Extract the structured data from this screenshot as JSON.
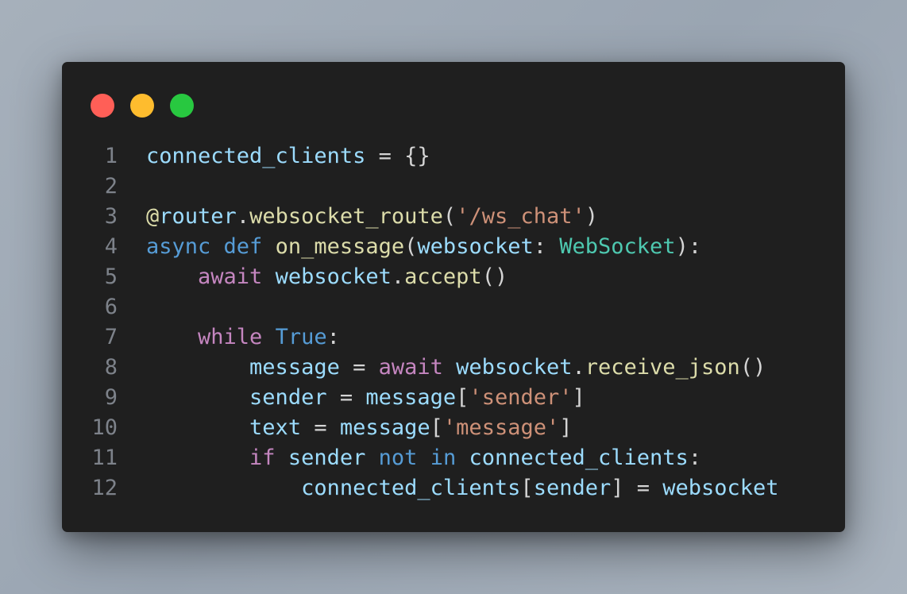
{
  "window": {
    "controls": [
      "close-dot",
      "minimize-dot",
      "maximize-dot"
    ],
    "colors": {
      "close": "#ff5f57",
      "minimize": "#febc2e",
      "maximize": "#28c840",
      "background": "#1f1f1f"
    }
  },
  "code": {
    "language": "python",
    "lines": [
      {
        "number": "1",
        "tokens": [
          {
            "t": "var",
            "s": "connected_clients"
          },
          {
            "t": "pun",
            "s": " = {}"
          }
        ]
      },
      {
        "number": "2",
        "tokens": []
      },
      {
        "number": "3",
        "tokens": [
          {
            "t": "fn",
            "s": "@"
          },
          {
            "t": "var",
            "s": "router"
          },
          {
            "t": "pun",
            "s": "."
          },
          {
            "t": "fn",
            "s": "websocket_route"
          },
          {
            "t": "pun",
            "s": "("
          },
          {
            "t": "str",
            "s": "'/ws_chat'"
          },
          {
            "t": "pun",
            "s": ")"
          }
        ]
      },
      {
        "number": "4",
        "tokens": [
          {
            "t": "kw",
            "s": "async"
          },
          {
            "t": "pun",
            "s": " "
          },
          {
            "t": "kw",
            "s": "def"
          },
          {
            "t": "pun",
            "s": " "
          },
          {
            "t": "fn",
            "s": "on_message"
          },
          {
            "t": "pun",
            "s": "("
          },
          {
            "t": "var",
            "s": "websocket"
          },
          {
            "t": "pun",
            "s": ": "
          },
          {
            "t": "type",
            "s": "WebSocket"
          },
          {
            "t": "pun",
            "s": "):"
          }
        ]
      },
      {
        "number": "5",
        "tokens": [
          {
            "t": "pun",
            "s": "    "
          },
          {
            "t": "ctl",
            "s": "await"
          },
          {
            "t": "pun",
            "s": " "
          },
          {
            "t": "var",
            "s": "websocket"
          },
          {
            "t": "pun",
            "s": "."
          },
          {
            "t": "fn",
            "s": "accept"
          },
          {
            "t": "pun",
            "s": "()"
          }
        ]
      },
      {
        "number": "6",
        "tokens": []
      },
      {
        "number": "7",
        "tokens": [
          {
            "t": "pun",
            "s": "    "
          },
          {
            "t": "ctl",
            "s": "while"
          },
          {
            "t": "pun",
            "s": " "
          },
          {
            "t": "kw",
            "s": "True"
          },
          {
            "t": "pun",
            "s": ":"
          }
        ]
      },
      {
        "number": "8",
        "tokens": [
          {
            "t": "pun",
            "s": "        "
          },
          {
            "t": "var",
            "s": "message"
          },
          {
            "t": "pun",
            "s": " = "
          },
          {
            "t": "ctl",
            "s": "await"
          },
          {
            "t": "pun",
            "s": " "
          },
          {
            "t": "var",
            "s": "websocket"
          },
          {
            "t": "pun",
            "s": "."
          },
          {
            "t": "fn",
            "s": "receive_json"
          },
          {
            "t": "pun",
            "s": "()"
          }
        ]
      },
      {
        "number": "9",
        "tokens": [
          {
            "t": "pun",
            "s": "        "
          },
          {
            "t": "var",
            "s": "sender"
          },
          {
            "t": "pun",
            "s": " = "
          },
          {
            "t": "var",
            "s": "message"
          },
          {
            "t": "pun",
            "s": "["
          },
          {
            "t": "str",
            "s": "'sender'"
          },
          {
            "t": "pun",
            "s": "]"
          }
        ]
      },
      {
        "number": "10",
        "tokens": [
          {
            "t": "pun",
            "s": "        "
          },
          {
            "t": "var",
            "s": "text"
          },
          {
            "t": "pun",
            "s": " = "
          },
          {
            "t": "var",
            "s": "message"
          },
          {
            "t": "pun",
            "s": "["
          },
          {
            "t": "str",
            "s": "'message'"
          },
          {
            "t": "pun",
            "s": "]"
          }
        ]
      },
      {
        "number": "11",
        "tokens": [
          {
            "t": "pun",
            "s": "        "
          },
          {
            "t": "ctl",
            "s": "if"
          },
          {
            "t": "pun",
            "s": " "
          },
          {
            "t": "var",
            "s": "sender"
          },
          {
            "t": "pun",
            "s": " "
          },
          {
            "t": "kw",
            "s": "not"
          },
          {
            "t": "pun",
            "s": " "
          },
          {
            "t": "kw",
            "s": "in"
          },
          {
            "t": "pun",
            "s": " "
          },
          {
            "t": "var",
            "s": "connected_clients"
          },
          {
            "t": "pun",
            "s": ":"
          }
        ]
      },
      {
        "number": "12",
        "tokens": [
          {
            "t": "pun",
            "s": "            "
          },
          {
            "t": "var",
            "s": "connected_clients"
          },
          {
            "t": "pun",
            "s": "["
          },
          {
            "t": "var",
            "s": "sender"
          },
          {
            "t": "pun",
            "s": "] = "
          },
          {
            "t": "var",
            "s": "websocket"
          }
        ]
      }
    ]
  }
}
